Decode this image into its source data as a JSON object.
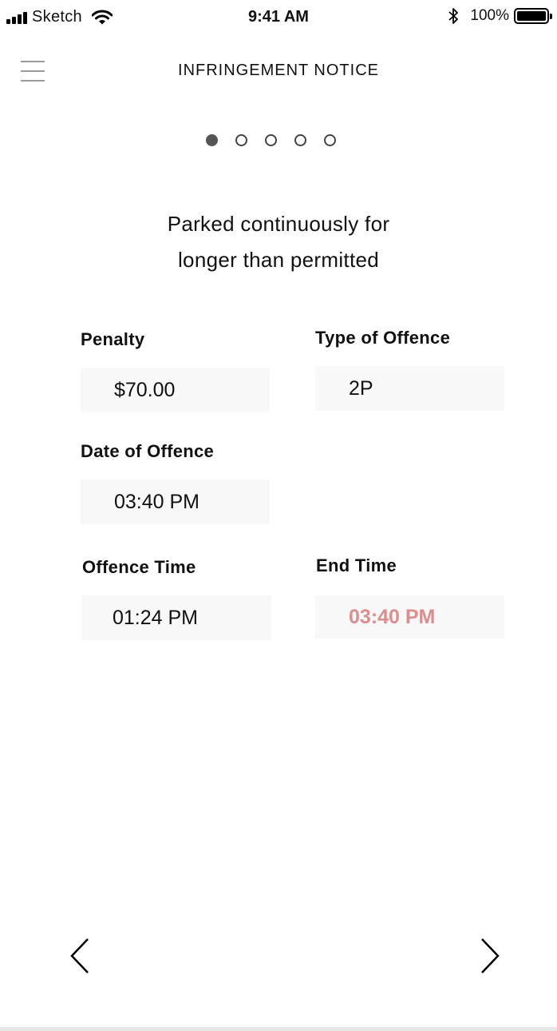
{
  "status_bar": {
    "carrier": "Sketch",
    "time": "9:41 AM",
    "battery": "100%",
    "icons": [
      "signal-icon",
      "wifi-icon",
      "bluetooth-icon",
      "battery-icon"
    ]
  },
  "header": {
    "title": "INFRINGEMENT NOTICE",
    "menu_icon": "hamburger-menu-icon"
  },
  "pager": {
    "total": 5,
    "active_index": 0
  },
  "notice": {
    "headline_line1": "Parked continuously for",
    "headline_line2": "longer than permitted"
  },
  "fields": {
    "penalty": {
      "label": "Penalty",
      "value": "$70.00"
    },
    "type_of_offence": {
      "label": "Type of Offence",
      "value": "2P"
    },
    "date_of_offence": {
      "label": "Date of Offence",
      "value": "03:40 PM"
    },
    "offence_time": {
      "label": "Offence Time",
      "value": "01:24 PM"
    },
    "end_time": {
      "label": "End Time",
      "value": "03:40 PM"
    }
  },
  "navigation": {
    "prev_icon": "chevron-left-icon",
    "next_icon": "chevron-right-icon"
  },
  "colors": {
    "end_time_value": "#dc8e8e",
    "field_background": "#f8f8f9",
    "active_dot": "#555555"
  }
}
